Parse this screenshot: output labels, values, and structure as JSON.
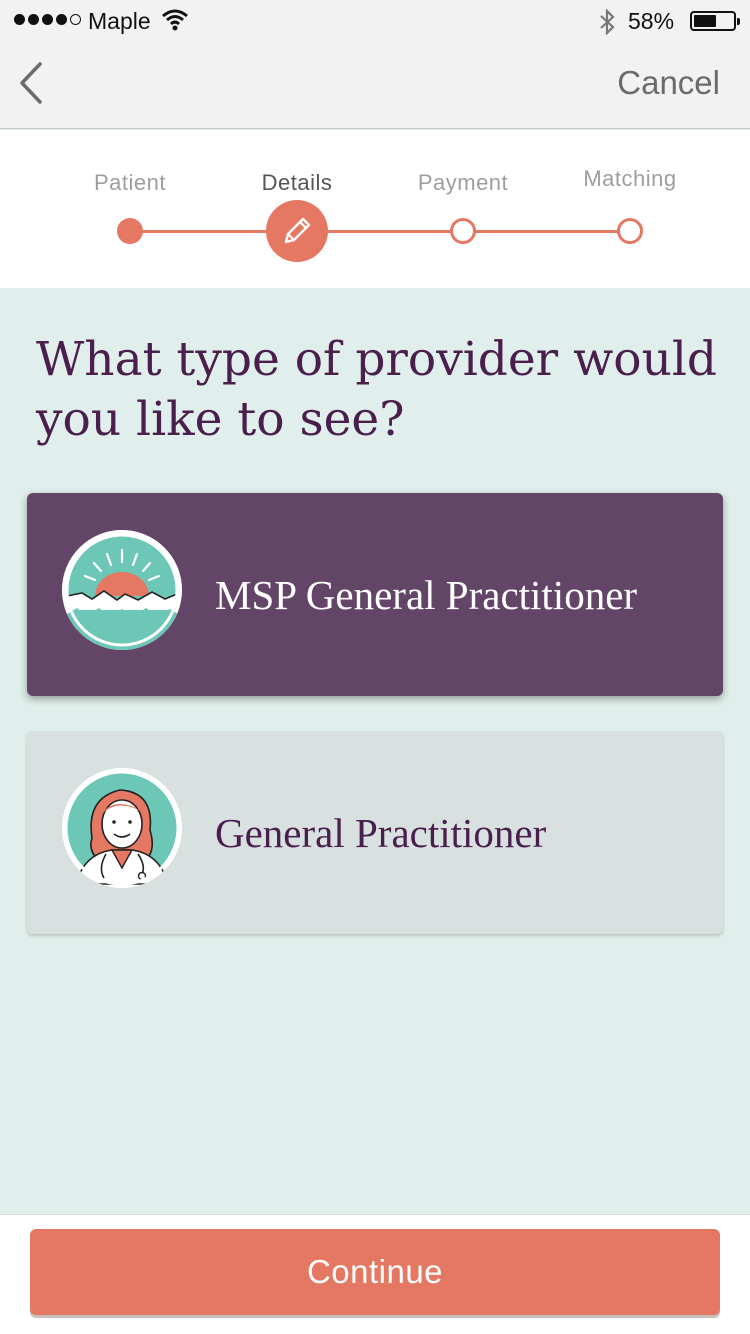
{
  "status_bar": {
    "carrier": "Maple",
    "battery_percent": "58%",
    "battery_level": 0.58,
    "signal_bars": 4,
    "signal_max": 5
  },
  "nav": {
    "back_icon": "chevron-left-icon",
    "cancel_label": "Cancel"
  },
  "stepper": {
    "steps": [
      {
        "label": "Patient",
        "state": "done"
      },
      {
        "label": "Details",
        "state": "current",
        "icon": "pencil-icon"
      },
      {
        "label": "Payment",
        "state": "todo"
      },
      {
        "label": "Matching",
        "state": "todo"
      }
    ],
    "accent_color": "#e57862"
  },
  "question": "What type of provider would you like to see?",
  "options": [
    {
      "label": "MSP General Practitioner",
      "icon": "sunrise-icon",
      "selected": true
    },
    {
      "label": "General Practitioner",
      "icon": "doctor-avatar-icon",
      "selected": false
    }
  ],
  "footer": {
    "continue_label": "Continue"
  },
  "colors": {
    "background": "#e0efeb",
    "selected_card": "#634667",
    "unselected_card": "#d8e1df",
    "heading": "#4a1f4d",
    "accent": "#e57862",
    "teal": "#6cc7b6"
  }
}
